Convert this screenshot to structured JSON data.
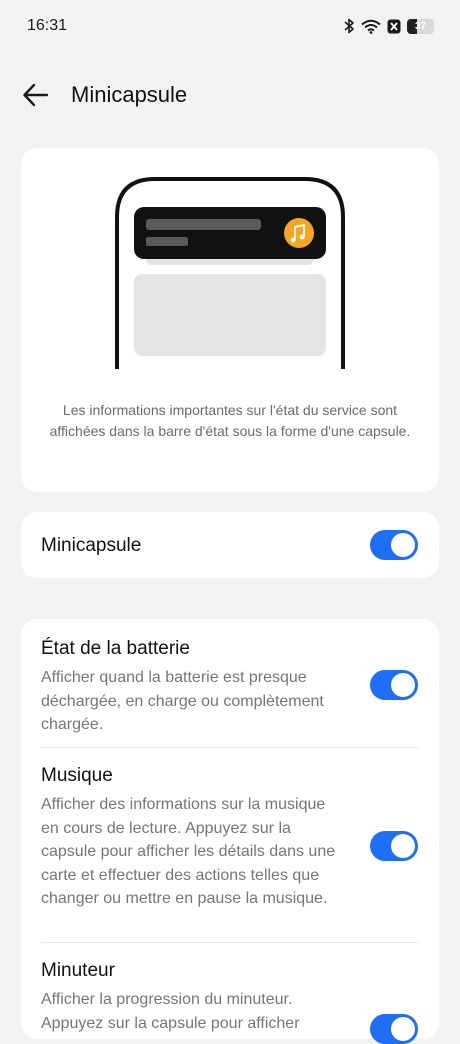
{
  "status_bar": {
    "time": "16:31",
    "battery_level": "37",
    "icons": [
      "bluetooth-icon",
      "wifi-icon",
      "notification-icon",
      "battery-icon"
    ]
  },
  "header": {
    "title": "Minicapsule"
  },
  "hero": {
    "description": "Les informations importantes sur l'état du service sont affichées dans la barre d'état sous la forme d'une capsule.",
    "accent_color": "#f5a623"
  },
  "main_toggle": {
    "label": "Minicapsule",
    "enabled": true
  },
  "items": [
    {
      "title": "État de la batterie",
      "description": "Afficher quand la batterie est presque déchargée, en charge ou complètement chargée.",
      "enabled": true
    },
    {
      "title": "Musique",
      "description": "Afficher des informations sur la musique en cours de lecture. Appuyez sur la capsule pour afficher les détails dans une carte et effectuer des actions telles que changer ou mettre en pause la musique.",
      "enabled": true
    },
    {
      "title": "Minuteur",
      "description": "Afficher la progression du minuteur. Appuyez sur la capsule pour afficher",
      "enabled": true
    }
  ],
  "colors": {
    "toggle_on": "#1e6ff5",
    "background": "#f2f2f4",
    "card": "#ffffff"
  }
}
